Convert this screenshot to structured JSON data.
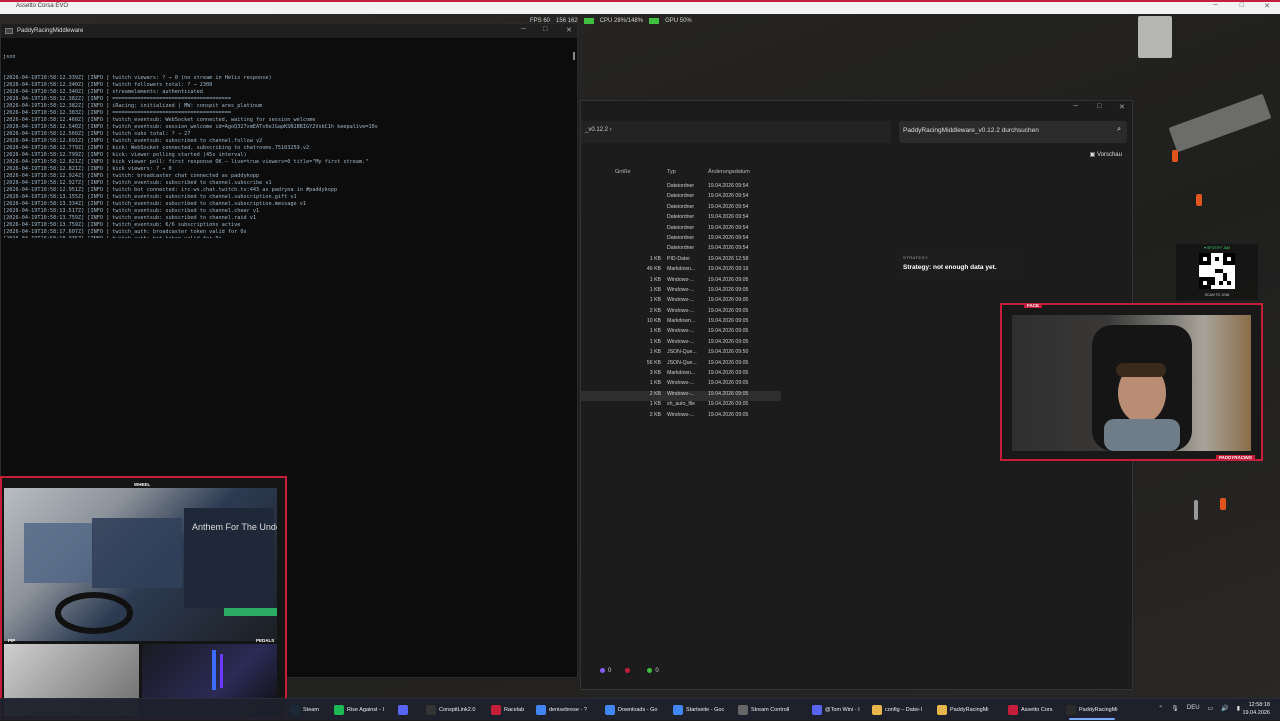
{
  "game_window": {
    "title": "Assetto Corsa EVO"
  },
  "perf": {
    "fps": "FPS 60",
    "frametime": "156 162",
    "cpu": "CPU 28%/148%",
    "gpu": "GPU 50%"
  },
  "console": {
    "title": "PaddyRacingMiddleware",
    "first_line": "json",
    "lines": [
      "[2026-04-19T10:58:12.339Z] [INFO ] twitch viewers: ? → 0 (no stream in Helix response)",
      "[2026-04-19T10:58:12.340Z] [INFO ] twitch followers total: ? → 2308",
      "[2026-04-19T10:58:12.340Z] [INFO ] streamelements: authenticated",
      "[2026-04-19T10:58:12.382Z] [INFO ] ======================================",
      "[2026-04-19T10:58:12.382Z] [INFO ] iRacing: initialized | MW: conspit ares_platinum",
      "[2026-04-19T10:58:12.383Z] [INFO ] ======================================",
      "[2026-04-19T10:58:12.460Z] [INFO ] twitch_eventsub: WebSocket connected, waiting for session_welcome",
      "[2026-04-19T10:58:12.540Z] [INFO ] twitch_eventsub: session_welcome id=AgoQ327xmEATs6eJGapKSN1BBIGY2VsbC1h keepalive=10s",
      "[2026-04-19T10:58:12.560Z] [INFO ] twitch subs total: ? → 27",
      "[2026-04-19T10:58:12.691Z] [INFO ] twitch_eventsub: subscribed to channel.follow v2",
      "[2026-04-19T10:58:12.779Z] [INFO ] kick: WebSocket connected, subscribing to chatrooms.75103259.v2",
      "[2026-04-19T10:58:12.799Z] [INFO ] kick: viewer polling started (45s interval)",
      "[2026-04-19T10:58:12.821Z] [INFO ] kick viewer poll: first response OK — live=true viewers=0 title=\"My first stream.\"",
      "[2026-04-19T10:58:12.821Z] [INFO ] kick viewers: ? → 0",
      "[2026-04-19T10:58:12.924Z] [INFO ] twitch: broadcaster chat connected as paddykopp",
      "[2026-04-19T10:58:12.927Z] [INFO ] twitch_eventsub: subscribed to channel.subscribe v1",
      "[2026-04-19T10:58:12.951Z] [INFO ] twitch bot connected: irc-ws.chat.twitch.tv:443 as padryna in #paddykopp",
      "[2026-04-19T10:58:13.155Z] [INFO ] twitch_eventsub: subscribed to channel.subscription.gift v1",
      "[2026-04-19T10:58:13.334Z] [INFO ] twitch_eventsub: subscribed to channel.subscription.message v1",
      "[2026-04-19T10:58:13.517Z] [INFO ] twitch_eventsub: subscribed to channel.cheer v1",
      "[2026-04-19T10:58:13.759Z] [INFO ] twitch_eventsub: subscribed to channel.raid v1",
      "[2026-04-19T10:58:13.759Z] [INFO ] twitch_eventsub: 6/6 subscriptions active",
      "[2026-04-19T10:58:17.607Z] [INFO ] twitch_auth: broadcaster token valid for 0s",
      "[2026-04-19T10:58:18.035Z] [INFO ] twitch_auth: bot token valid for 0s"
    ]
  },
  "explorer": {
    "address": "_v0.12.2",
    "search_placeholder": "PaddyRacingMiddleware_v0.12.2 durchsuchen",
    "preview_label": "Vorschau",
    "columns": {
      "size": "Größe",
      "type": "Typ",
      "date": "Änderungsdatum"
    },
    "rows": [
      {
        "size": "",
        "type": "Dateiordner",
        "date": "19.04.2026 09:54"
      },
      {
        "size": "",
        "type": "Dateiordner",
        "date": "19.04.2026 09:54"
      },
      {
        "size": "",
        "type": "Dateiordner",
        "date": "19.04.2026 09:54"
      },
      {
        "size": "",
        "type": "Dateiordner",
        "date": "19.04.2026 09:54"
      },
      {
        "size": "",
        "type": "Dateiordner",
        "date": "19.04.2026 09:54"
      },
      {
        "size": "",
        "type": "Dateiordner",
        "date": "19.04.2026 09:54"
      },
      {
        "size": "",
        "type": "Dateiordner",
        "date": "19.04.2026 09:54"
      },
      {
        "size": "1 KB",
        "type": "PID-Datei",
        "date": "19.04.2026 12:58"
      },
      {
        "size": "46 KB",
        "type": "Markdown...",
        "date": "19.04.2026 09:19"
      },
      {
        "size": "1 KB",
        "type": "Windows-...",
        "date": "19.04.2026 09:05"
      },
      {
        "size": "1 KB",
        "type": "Windows-...",
        "date": "19.04.2026 09:05"
      },
      {
        "size": "1 KB",
        "type": "Windows-...",
        "date": "19.04.2026 09:05"
      },
      {
        "size": "2 KB",
        "type": "Windows-...",
        "date": "19.04.2026 09:05"
      },
      {
        "size": "10 KB",
        "type": "Markdown...",
        "date": "19.04.2026 09:05"
      },
      {
        "size": "1 KB",
        "type": "Windows-...",
        "date": "19.04.2026 09:05"
      },
      {
        "size": "1 KB",
        "type": "Windows-...",
        "date": "19.04.2026 09:05"
      },
      {
        "size": "1 KB",
        "type": "JSON-Que...",
        "date": "19.04.2026 09:50"
      },
      {
        "size": "56 KB",
        "type": "JSON-Que...",
        "date": "19.04.2026 09:05"
      },
      {
        "size": "3 KB",
        "type": "Markdown...",
        "date": "19.04.2026 09:05"
      },
      {
        "size": "1 KB",
        "type": "Windows-...",
        "date": "19.04.2026 09:05"
      },
      {
        "size": "2 KB",
        "type": "Windows-...",
        "date": "19.04.2026 09:05"
      },
      {
        "size": "1 KB",
        "type": "sh_auto_file",
        "date": "19.04.2026 09:05"
      },
      {
        "size": "2 KB",
        "type": "Windows-...",
        "date": "19.04.2026 09:05"
      }
    ],
    "selected_row": 20
  },
  "strategy": {
    "label": "STRATEGY",
    "text": "Strategy: not enough data yet."
  },
  "spotify": {
    "label": "♥ SPOTIFY JAM",
    "scan": "SCAN TO JOIN"
  },
  "facecam": {
    "label": "FACE",
    "brand": "PADDYRACING"
  },
  "wheelcam": {
    "label": "WHEEL",
    "pip": "PIP",
    "pedals": "PEDALS"
  },
  "hud": {
    "counters": [
      "0",
      "",
      "0"
    ]
  },
  "taskbar": {
    "items": [
      {
        "label": "Steam",
        "icon": "steam-icon",
        "color": "#1b2838"
      },
      {
        "label": "Rise Against - I",
        "icon": "spotify-icon",
        "color": "#1db954"
      },
      {
        "label": "",
        "icon": "discord-icon",
        "color": "#5865f2"
      },
      {
        "label": "ConspitLink2.0",
        "icon": "conspit-icon",
        "color": "#333333"
      },
      {
        "label": "Racelab",
        "icon": "racelab-icon",
        "color": "#c41e3a"
      },
      {
        "label": "denisebrese - ?",
        "icon": "chrome-icon",
        "color": "#4285f4"
      },
      {
        "label": "Downloads - Go",
        "icon": "chrome-icon",
        "color": "#4285f4"
      },
      {
        "label": "Startseite - Goc",
        "icon": "chrome-icon",
        "color": "#4285f4"
      },
      {
        "label": "Stream Controll",
        "icon": "app-icon",
        "color": "#666666"
      },
      {
        "label": "@Tom Wini - I",
        "icon": "discord-icon",
        "color": "#5865f2"
      },
      {
        "label": "config – Datei-I",
        "icon": "folder-icon",
        "color": "#e8b64c"
      },
      {
        "label": "PaddyRacingMi",
        "icon": "folder-icon",
        "color": "#e8b64c"
      },
      {
        "label": "Assetto Cors",
        "icon": "ac-icon",
        "color": "#c41e3a"
      },
      {
        "label": "PaddyRacingMi",
        "icon": "terminal-icon",
        "color": "#2b2b2b"
      }
    ],
    "tray_lang": "DEU",
    "time": "12:58:18",
    "date": "19.04.2026"
  }
}
